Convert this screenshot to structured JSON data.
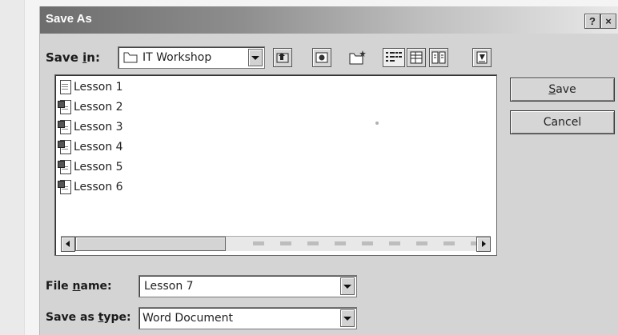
{
  "dialog": {
    "title": "Save As",
    "help_label": "?",
    "close_label": "×"
  },
  "save_in": {
    "label_pre": "Save ",
    "label_accel": "i",
    "label_post": "n:",
    "folder": "IT Workshop"
  },
  "toolbar": {
    "icons": [
      "back-icon",
      "up-one-level-icon",
      "search-web-icon",
      "create-new-folder-icon",
      "list-view-icon",
      "details-view-icon",
      "properties-view-icon",
      "tools-icon"
    ]
  },
  "files": [
    {
      "name": "Lesson 1"
    },
    {
      "name": "Lesson 2"
    },
    {
      "name": "Lesson 3"
    },
    {
      "name": "Lesson 4"
    },
    {
      "name": "Lesson 5"
    },
    {
      "name": "Lesson 6"
    }
  ],
  "buttons": {
    "save_accel": "S",
    "save_rest": "ave",
    "cancel": "Cancel"
  },
  "file_name": {
    "label_pre": "File ",
    "label_accel": "n",
    "label_post": "ame:",
    "value": "Lesson 7"
  },
  "save_as_type": {
    "label_pre": "Save as ",
    "label_accel": "t",
    "label_post": "ype:",
    "value": "Word Document"
  }
}
